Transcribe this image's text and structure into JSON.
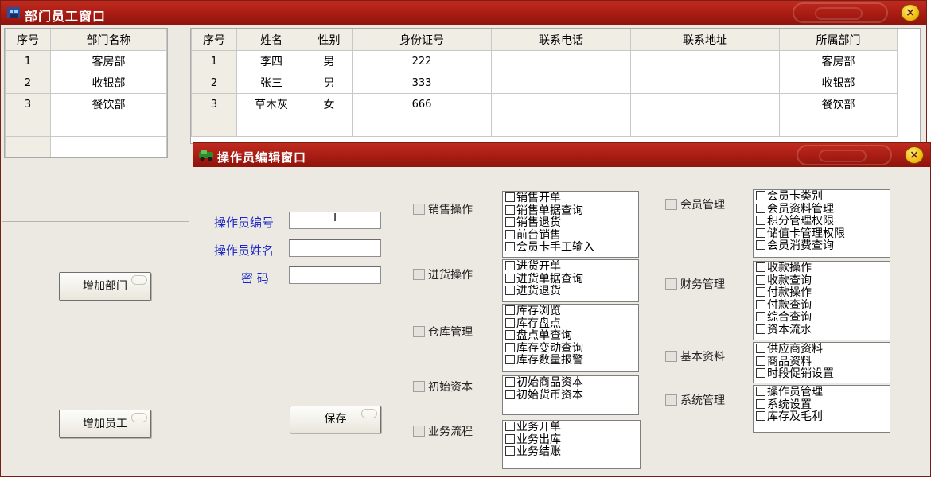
{
  "dept_window": {
    "title": "部门员工窗口",
    "close": "×",
    "dept_table": {
      "headers": [
        "序号",
        "部门名称"
      ],
      "rows": [
        [
          "1",
          "客房部"
        ],
        [
          "2",
          "收银部"
        ],
        [
          "3",
          "餐饮部"
        ],
        [
          "",
          ""
        ],
        [
          "",
          ""
        ]
      ]
    },
    "emp_table": {
      "headers": [
        "序号",
        "姓名",
        "性别",
        "身份证号",
        "联系电话",
        "联系地址",
        "所属部门"
      ],
      "rows": [
        [
          "1",
          "李四",
          "男",
          "222",
          "",
          "",
          "客房部"
        ],
        [
          "2",
          "张三",
          "男",
          "333",
          "",
          "",
          "收银部"
        ],
        [
          "3",
          "草木灰",
          "女",
          "666",
          "",
          "",
          "餐饮部"
        ],
        [
          "",
          "",
          "",
          "",
          "",
          "",
          ""
        ]
      ]
    },
    "add_dept_label": "增加部门",
    "add_emp_label": "增加员工"
  },
  "op_window": {
    "title": "操作员编辑窗口",
    "close": "×",
    "fields": {
      "op_id_label": "操作员编号",
      "op_id_value": "I",
      "op_name_label": "操作员姓名",
      "op_name_value": "",
      "password_label": "密 码",
      "password_value": ""
    },
    "save_label": "保存",
    "left_groups": [
      {
        "name": "销售操作",
        "items": [
          "销售开单",
          "销售单据查询",
          "销售退货",
          "前台销售",
          "会员卡手工输入"
        ]
      },
      {
        "name": "进货操作",
        "items": [
          "进货开单",
          "进货单据查询",
          "进货退货"
        ]
      },
      {
        "name": "仓库管理",
        "items": [
          "库存浏览",
          "库存盘点",
          "盘点单查询",
          "库存变动查询",
          "库存数量报警"
        ]
      },
      {
        "name": "初始资本",
        "items": [
          "初始商品资本",
          "初始货币资本"
        ]
      },
      {
        "name": "业务流程",
        "items": [
          "业务开单",
          "业务出库",
          "业务结账"
        ]
      }
    ],
    "right_groups": [
      {
        "name": "会员管理",
        "items": [
          "会员卡类别",
          "会员资料管理",
          "积分管理权限",
          "储值卡管理权限",
          "会员消费查询"
        ]
      },
      {
        "name": "财务管理",
        "items": [
          "收款操作",
          "收款查询",
          "付款操作",
          "付款查询",
          "综合查询",
          "资本流水"
        ]
      },
      {
        "name": "基本资料",
        "items": [
          "供应商资料",
          "商品资料",
          "时段促销设置"
        ]
      },
      {
        "name": "系统管理",
        "items": [
          "操作员管理",
          "系统设置",
          "库存及毛利"
        ]
      }
    ]
  }
}
